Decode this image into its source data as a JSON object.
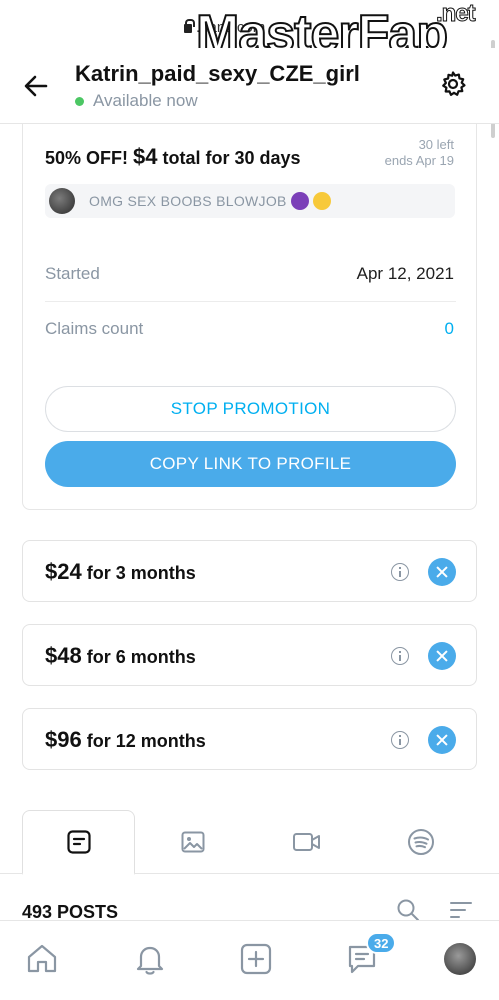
{
  "browser": {
    "url_partial": "...ans.com",
    "watermark": "MasterFap",
    "watermark_suffix": ".net"
  },
  "header": {
    "title": "Katrin_paid_sexy_CZE_girl",
    "status": "Available now"
  },
  "promotion": {
    "title_prefix": "50% OFF! ",
    "title_price": "$4",
    "title_suffix": " total for 30 days",
    "left": "30 left",
    "ends": "ends Apr 19",
    "message": "OMG SEX BOOBS BLOWJOB",
    "started_label": "Started",
    "started_value": "Apr 12, 2021",
    "claims_label": "Claims count",
    "claims_value": "0",
    "stop_label": "STOP PROMOTION",
    "copy_label": "COPY LINK TO PROFILE"
  },
  "bundles": [
    {
      "price": "$24",
      "term": " for 3 months"
    },
    {
      "price": "$48",
      "term": " for 6 months"
    },
    {
      "price": "$96",
      "term": " for 12 months"
    }
  ],
  "tabs": [
    {
      "icon": "posts-icon"
    },
    {
      "icon": "photo-icon"
    },
    {
      "icon": "video-icon"
    },
    {
      "icon": "audio-icon"
    }
  ],
  "posts": {
    "count_label": "493 POSTS"
  },
  "nav": {
    "messages_badge": "32"
  },
  "colors": {
    "accent": "#00aff0",
    "button": "#4aabea",
    "online": "#4cc764",
    "muted": "#8a96a3"
  }
}
